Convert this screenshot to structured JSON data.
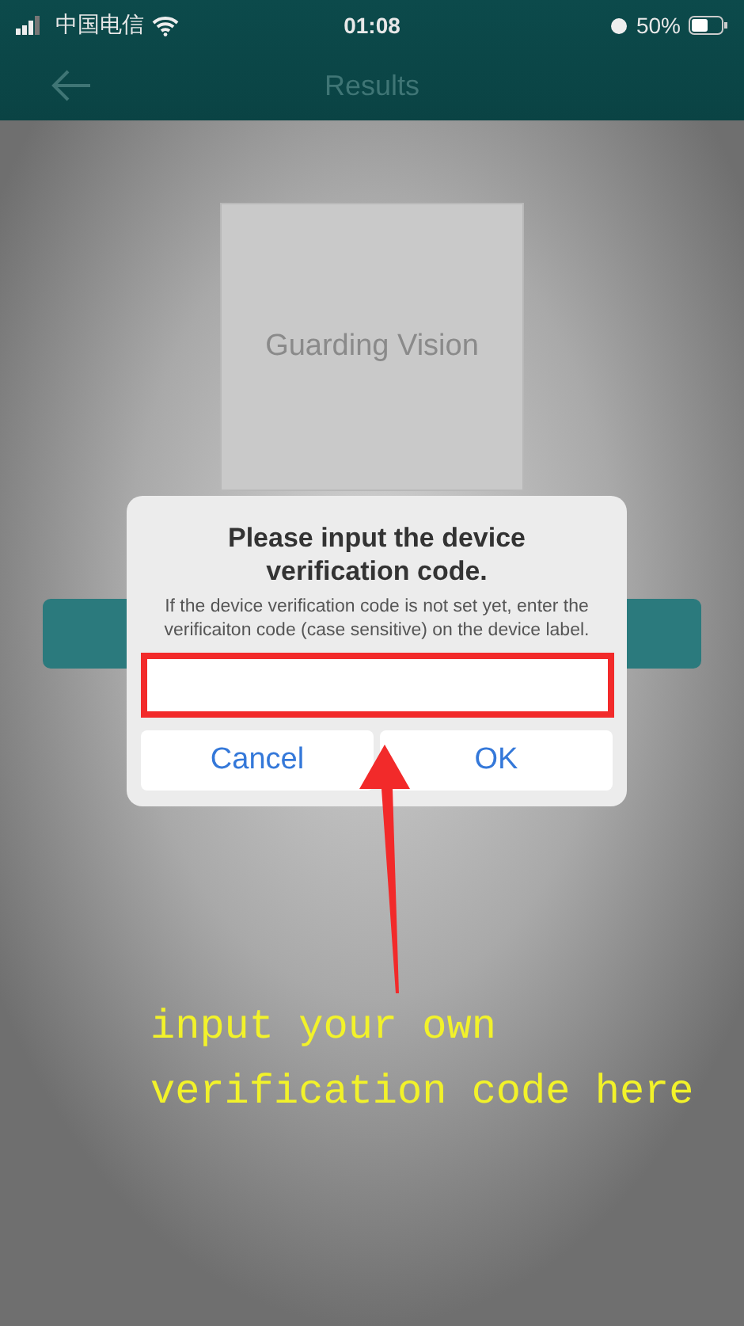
{
  "status_bar": {
    "carrier": "中国电信",
    "time": "01:08",
    "battery": "50%"
  },
  "nav": {
    "title": "Results"
  },
  "logo_card": {
    "text": "Guarding Vision"
  },
  "dialog": {
    "title": "Please input the device verification code.",
    "message": "If the device verification code is not set yet, enter the verificaiton code (case sensitive) on the device label.",
    "buttons": [
      {
        "label": "Cancel"
      },
      {
        "label": "OK"
      }
    ]
  },
  "annotation": {
    "text": "input your own verification code here"
  }
}
